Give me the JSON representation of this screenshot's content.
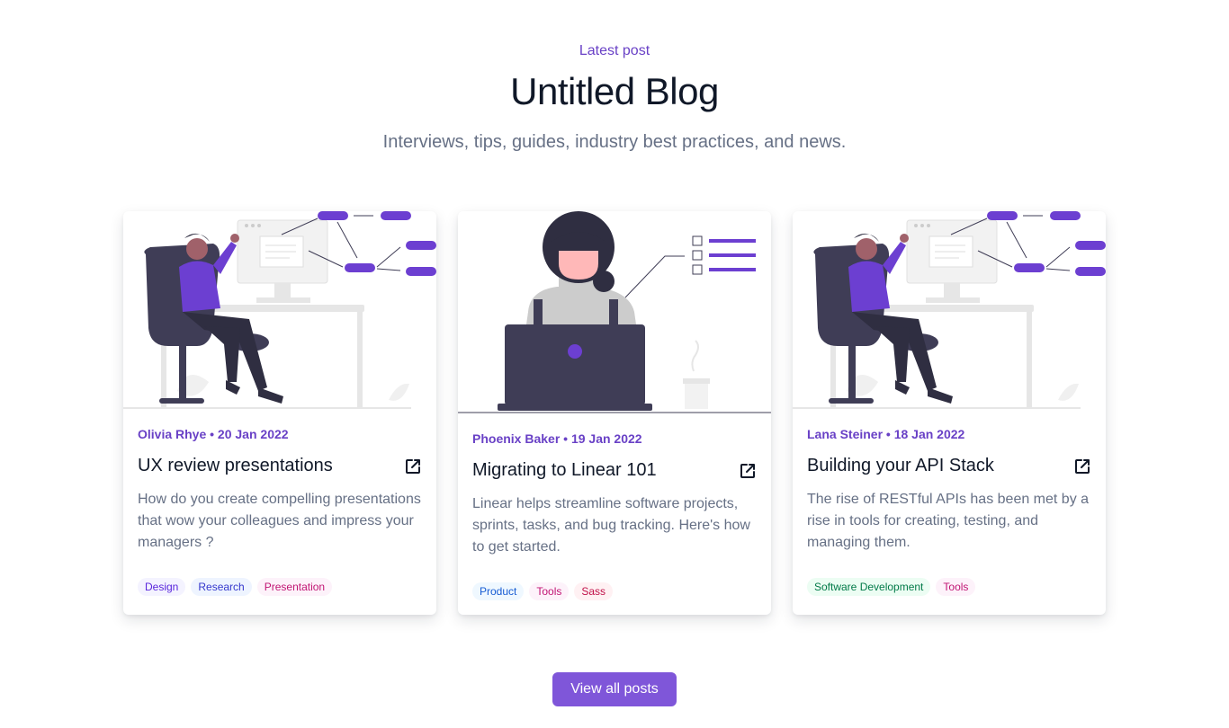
{
  "header": {
    "eyebrow": "Latest post",
    "title": "Untitled Blog",
    "subtitle": "Interviews, tips, guides, industry best practices, and news."
  },
  "posts": [
    {
      "meta": "Olivia Rhye • 20 Jan 2022",
      "title": "UX review presentations",
      "excerpt": "How do you create compelling presentations that wow your colleagues and impress your managers ?",
      "tags": [
        {
          "label": "Design",
          "bg": "#f4f3ff",
          "fg": "#5925dc"
        },
        {
          "label": "Research",
          "bg": "#eef4ff",
          "fg": "#3538cd"
        },
        {
          "label": "Presentation",
          "bg": "#fdf2fa",
          "fg": "#c11574"
        }
      ],
      "icon": "external-link-icon"
    },
    {
      "meta": "Phoenix Baker • 19 Jan 2022",
      "title": "Migrating to Linear 101",
      "excerpt": "Linear helps streamline software projects, sprints, tasks, and bug tracking. Here's how to get started.",
      "tags": [
        {
          "label": "Product",
          "bg": "#eff8ff",
          "fg": "#175cd3"
        },
        {
          "label": "Tools",
          "bg": "#fdf2fa",
          "fg": "#c11574"
        },
        {
          "label": "Sass",
          "bg": "#fff1f3",
          "fg": "#c01048"
        }
      ],
      "icon": "external-link-icon"
    },
    {
      "meta": "Lana Steiner • 18 Jan 2022",
      "title": "Building your API Stack",
      "excerpt": "The rise of RESTful APIs has been met by a rise in tools for creating, testing, and managing them.",
      "tags": [
        {
          "label": "Software Development",
          "bg": "#ecfdf3",
          "fg": "#027a48"
        },
        {
          "label": "Tools",
          "bg": "#fdf2fa",
          "fg": "#c11574"
        }
      ],
      "icon": "external-link-icon"
    }
  ],
  "cta": {
    "label": "View all posts"
  },
  "colors": {
    "accent": "#7f56d9",
    "accent_text": "#6941c6",
    "illustration_purple": "#6c3fd1",
    "illustration_dark": "#3f3d56"
  }
}
